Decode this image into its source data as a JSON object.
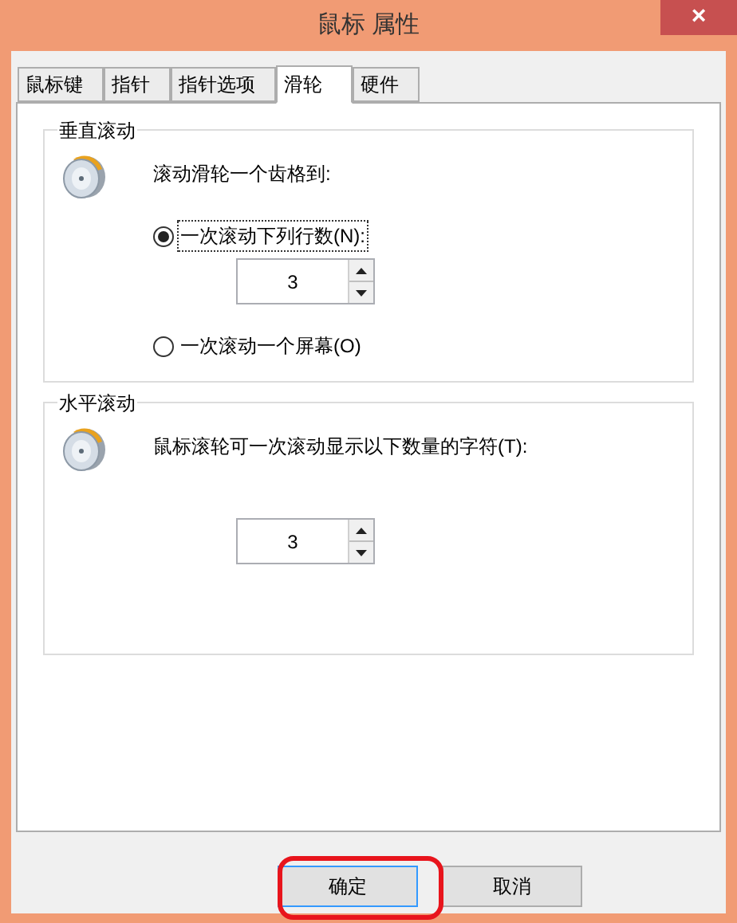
{
  "window": {
    "title": "鼠标 属性",
    "close": "×"
  },
  "tabs": [
    {
      "label": "鼠标键",
      "selected": false
    },
    {
      "label": "指针",
      "selected": false
    },
    {
      "label": "指针选项",
      "selected": false
    },
    {
      "label": "滑轮",
      "selected": true
    },
    {
      "label": "硬件",
      "selected": false
    }
  ],
  "vertical_scrolling": {
    "title": "垂直滚动",
    "prompt": "滚动滑轮一个齿格到:",
    "options": [
      {
        "label": "一次滚动下列行数(N):",
        "selected": true,
        "spinner": "3"
      },
      {
        "label": "一次滚动一个屏幕(O)",
        "selected": false
      }
    ]
  },
  "horizontal_scrolling": {
    "title": "水平滚动",
    "prompt": "鼠标滚轮可一次滚动显示以下数量的字符(T):",
    "spinner": "3"
  },
  "buttons": [
    {
      "label": "确定",
      "focused": true
    },
    {
      "label": "取消",
      "focused": false
    }
  ]
}
